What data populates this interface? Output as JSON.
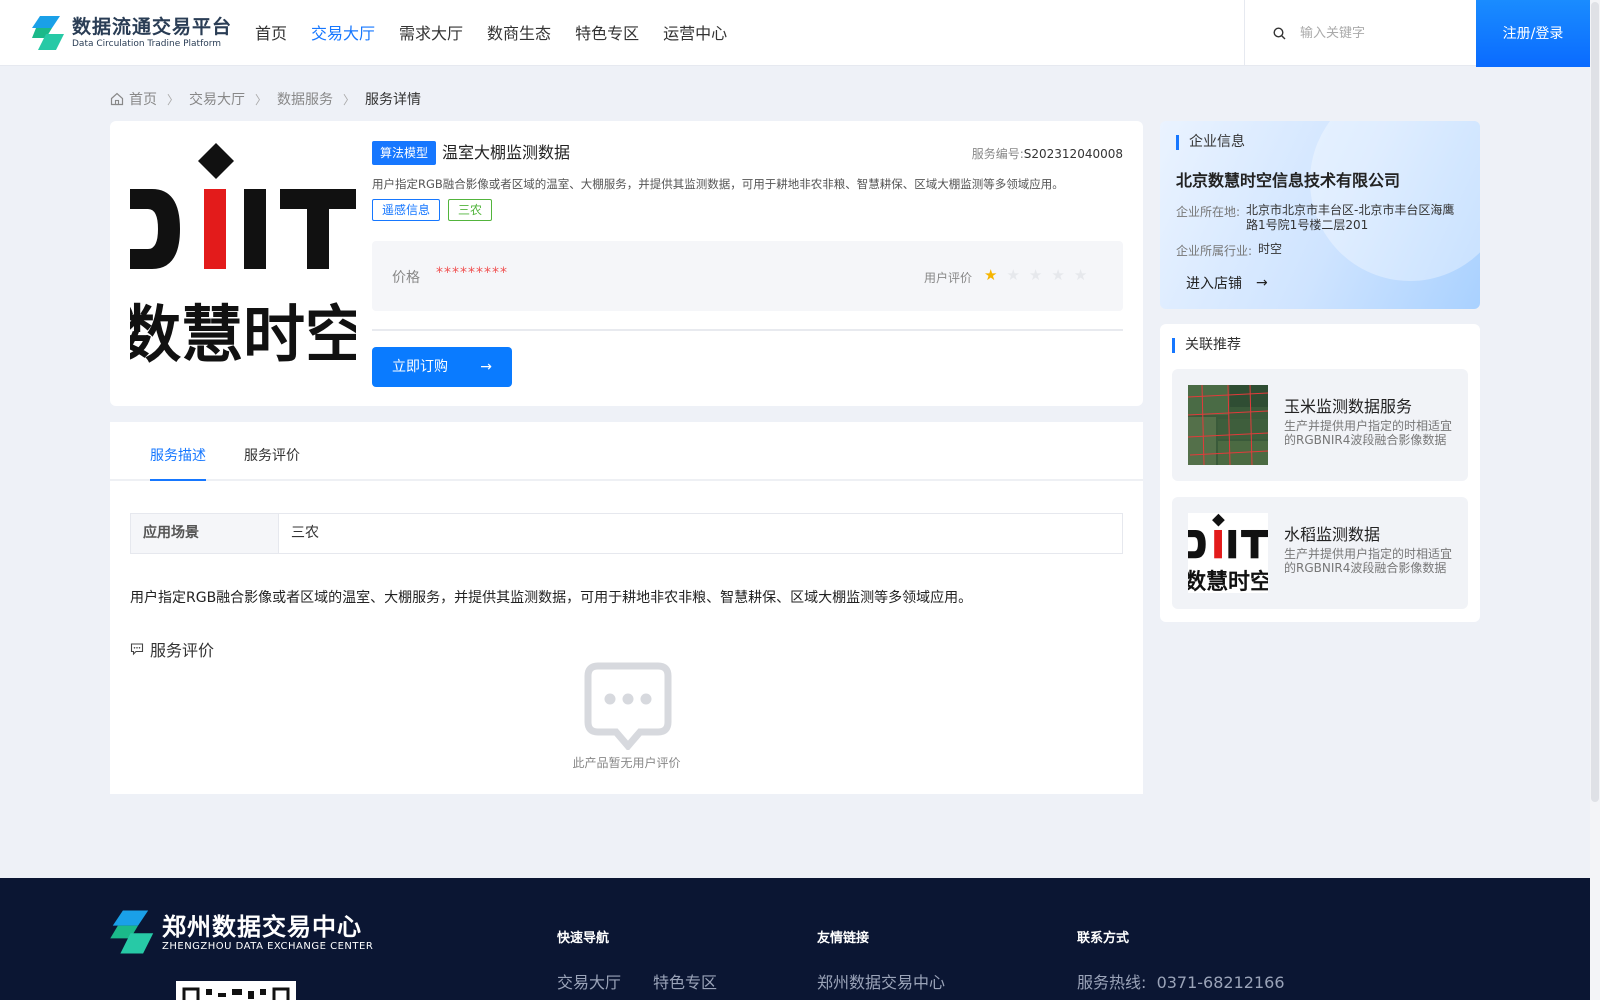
{
  "header": {
    "logo_cn": "数据流通交易平台",
    "logo_en": "Data Circulation Tradine Platform",
    "nav": [
      {
        "label": "首页",
        "active": false
      },
      {
        "label": "交易大厅",
        "active": true
      },
      {
        "label": "需求大厅",
        "active": false
      },
      {
        "label": "数商生态",
        "active": false
      },
      {
        "label": "特色专区",
        "active": false
      },
      {
        "label": "运营中心",
        "active": false
      }
    ],
    "search_placeholder": "输入关键字",
    "login_label": "注册/登录"
  },
  "breadcrumb": [
    "首页",
    "交易大厅",
    "数据服务",
    "服务详情"
  ],
  "product": {
    "logo_text_top": "DIIT",
    "logo_text_bottom": "数慧时空",
    "type_tag": "算法模型",
    "title": "温室大棚监测数据",
    "service_no_label": "服务编号:",
    "service_no": "S202312040008",
    "description": "用户指定RGB融合影像或者区域的温室、大棚服务，并提供其监测数据，可用于耕地非农非粮、智慧耕保、区域大棚监测等多领域应用。",
    "tags": [
      "遥感信息",
      "三农"
    ],
    "price_label": "价格",
    "price_value": "*********",
    "rating_label": "用户评价",
    "rating": 1,
    "rating_max": 5,
    "buy_label": "立即订购"
  },
  "detail": {
    "tabs": [
      "服务描述",
      "服务评价"
    ],
    "active_tab": 0,
    "scene_label": "应用场景",
    "scene_value": "三农",
    "description": "用户指定RGB融合影像或者区域的温室、大棚服务，并提供其监测数据，可用于耕地非农非粮、智慧耕保、区域大棚监测等多领域应用。",
    "review_title": "服务评价",
    "empty_text": "此产品暂无用户评价"
  },
  "enterprise": {
    "section_title": "企业信息",
    "name": "北京数慧时空信息技术有限公司",
    "location_label": "企业所在地:",
    "location": "北京市北京市丰台区-北京市丰台区海鹰路1号院1号楼二层201",
    "industry_label": "企业所属行业:",
    "industry": "时空",
    "shop_link": "进入店铺"
  },
  "recommend": {
    "section_title": "关联推荐",
    "items": [
      {
        "title": "玉米监测数据服务",
        "desc": "生产并提供用户指定的时相适宜的RGBNIR4波段融合影像数据"
      },
      {
        "title": "水稻监测数据",
        "desc": "生产并提供用户指定的时相适宜的RGBNIR4波段融合影像数据"
      }
    ]
  },
  "footer": {
    "logo_cn": "郑州数据交易中心",
    "logo_en": "ZHENGZHOU DATA EXCHANGE CENTER",
    "quick_nav_title": "快速导航",
    "quick_nav": [
      "交易大厅",
      "特色专区"
    ],
    "friend_links_title": "友情链接",
    "friend_links": [
      "郑州数据交易中心"
    ],
    "contact_title": "联系方式",
    "hotline": "服务热线:  0371-68212166"
  },
  "colors": {
    "accent": "#1677ff",
    "footer_bg": "#0b1633",
    "price": "#f05050",
    "star": "#f6b500"
  }
}
